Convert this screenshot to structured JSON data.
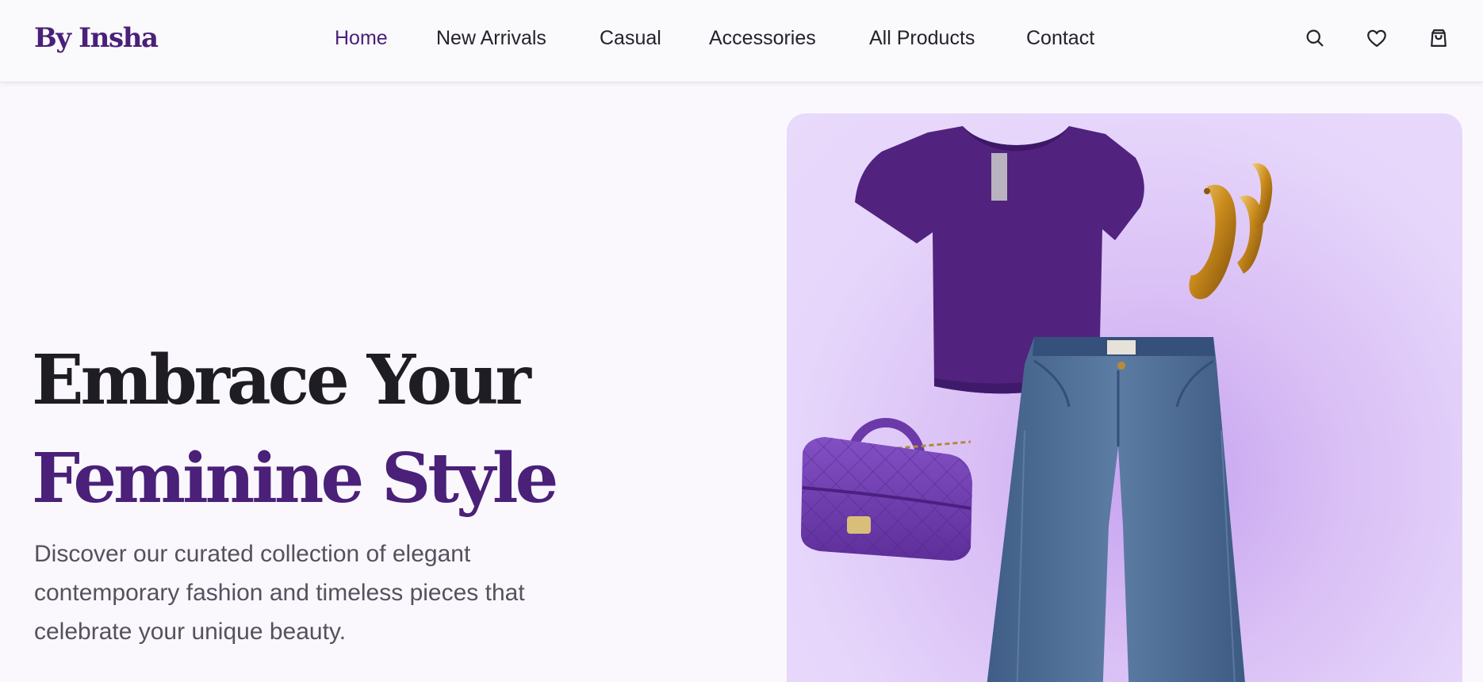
{
  "brand": {
    "logo": "By Insha"
  },
  "nav": {
    "items": [
      {
        "label": "Home",
        "active": true
      },
      {
        "label": "New Arrivals",
        "active": false
      },
      {
        "label": "Casual",
        "active": false
      },
      {
        "label": "Accessories",
        "active": false
      },
      {
        "label": "All Products",
        "active": false
      },
      {
        "label": "Contact",
        "active": false
      }
    ]
  },
  "header_icons": [
    "search-icon",
    "heart-icon",
    "shopping-bag-icon"
  ],
  "hero": {
    "title_line1": "Embrace Your",
    "title_line2": "Feminine Style",
    "description": "Discover our curated collection of elegant contemporary fashion and timeless pieces that celebrate your unique beauty.",
    "image_items": [
      "purple crop t-shirt",
      "gold hoop earrings",
      "purple quilted handbag",
      "wide-leg denim jeans"
    ]
  },
  "colors": {
    "brand": "#4a2079",
    "page_bg": "#faf8fd",
    "hero_panel": "#e6d6fb",
    "text_dark": "#1f1d24",
    "text_muted": "#56515e"
  }
}
